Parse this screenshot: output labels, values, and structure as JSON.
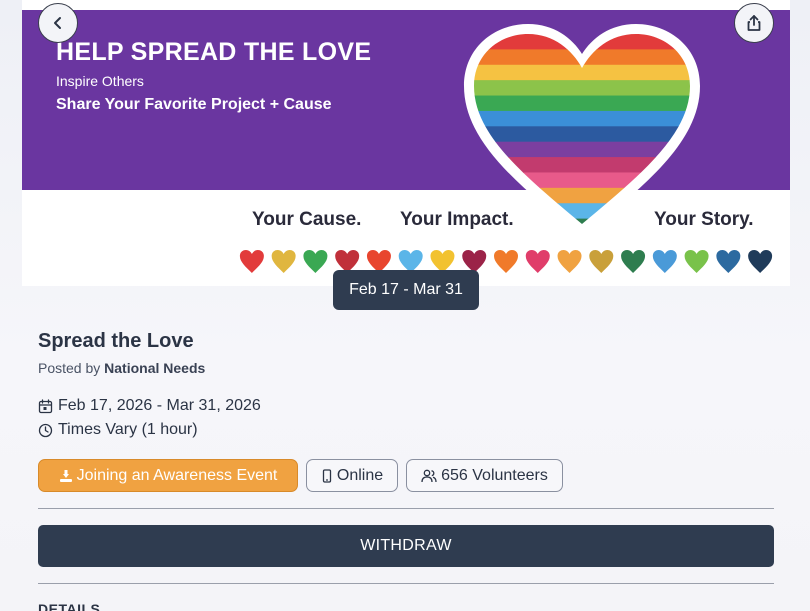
{
  "banner": {
    "headline": "HELP SPREAD THE LOVE",
    "sub1": "Inspire Others",
    "sub2": "Share Your Favorite Project + Cause",
    "tag_cause": "Your Cause.",
    "tag_impact": "Your Impact.",
    "tag_story": "Your Story.",
    "stripe_colors": [
      "#e23b3b",
      "#f07a2a",
      "#f5c242",
      "#8cc34a",
      "#3aa853",
      "#3b8fd8",
      "#2c5aa0",
      "#7b3fa0",
      "#c23b6e",
      "#e85a8a",
      "#f0a241",
      "#5bb5e8",
      "#2e7d4f"
    ],
    "small_heart_colors": [
      "#e23b3b",
      "#e0b63f",
      "#3aa853",
      "#c0303a",
      "#e8452e",
      "#5bb5e8",
      "#f2c230",
      "#9b2348",
      "#f07a2a",
      "#e03d6a",
      "#f0a241",
      "#c9a03a",
      "#2e7d4f",
      "#4a9ad8",
      "#79c24a",
      "#2c6aa0",
      "#1f3b5a"
    ]
  },
  "nav": {
    "back_icon": "chevron-left-icon",
    "share_icon": "share-icon"
  },
  "date_pill": "Feb 17 - Mar 31",
  "event": {
    "title": "Spread the Love",
    "posted_prefix": "Posted by",
    "posted_by": "National Needs",
    "date_range": "Feb 17, 2026 - Mar 31, 2026",
    "times": "Times Vary (1 hour)"
  },
  "chips": {
    "awareness": "Joining an Awareness Event",
    "online": "Online",
    "volunteers": "656 Volunteers"
  },
  "actions": {
    "withdraw": "WITHDRAW"
  },
  "section": {
    "details": "DETAILS"
  },
  "colors": {
    "primary_dark": "#2f3c50",
    "accent_orange": "#f0a241",
    "banner_purple": "#6a36a0"
  }
}
